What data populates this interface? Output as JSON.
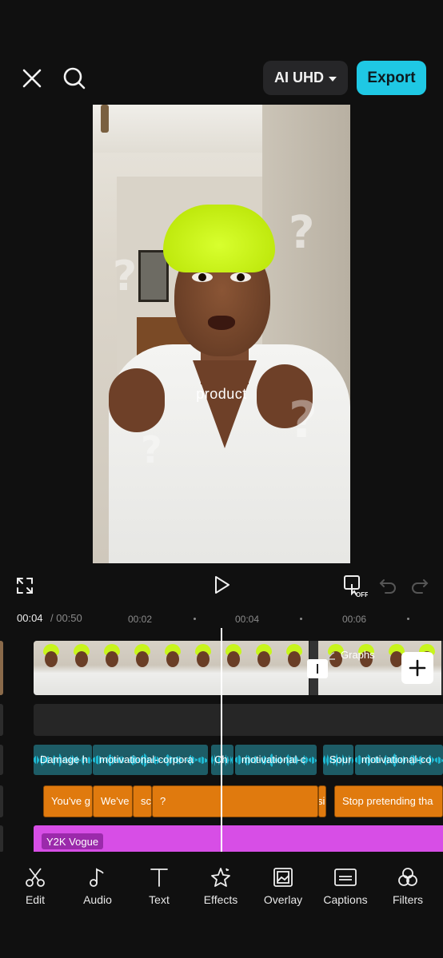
{
  "topbar": {
    "quality_label": "AI UHD",
    "export_label": "Export"
  },
  "preview": {
    "overlay_text": "product",
    "question_marks": [
      "?",
      "?",
      "?",
      "?"
    ]
  },
  "timeline": {
    "current_time": "00:04",
    "total_time": "/ 00:50",
    "ticks": [
      "00:02",
      "00:04",
      "00:06"
    ],
    "graphs_label": "Graphs",
    "audio_clips": [
      "Damage h",
      "motivational-corpora",
      "Ch",
      "motivational-c",
      "Sour",
      "motivational-co"
    ],
    "text_clips": [
      "You've g",
      "We've",
      "sc",
      "?",
      "si",
      "Stop pretending tha"
    ],
    "effect_label": "Y2K Vogue"
  },
  "toolbar": {
    "items": [
      {
        "label": "Edit",
        "icon": "scissors-icon"
      },
      {
        "label": "Audio",
        "icon": "music-note-icon"
      },
      {
        "label": "Text",
        "icon": "text-icon"
      },
      {
        "label": "Effects",
        "icon": "sparkle-star-icon"
      },
      {
        "label": "Overlay",
        "icon": "overlay-image-icon"
      },
      {
        "label": "Captions",
        "icon": "captions-icon"
      },
      {
        "label": "Filters",
        "icon": "filters-icon"
      }
    ]
  },
  "colors": {
    "accent": "#1fc8e4",
    "audio_track": "#1d5c66",
    "text_track": "#e07a0e",
    "effect_track": "#d74ee6"
  }
}
